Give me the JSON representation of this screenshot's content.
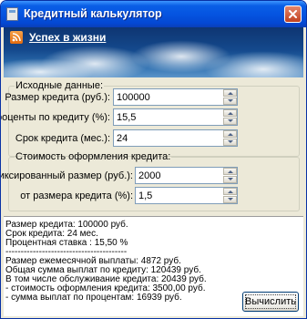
{
  "window": {
    "title": "Кредитный калькулятор"
  },
  "banner": {
    "link_text": "Успех в жизни"
  },
  "initial_group": {
    "legend": "Исходные данные:",
    "fields": [
      {
        "label": "Размер кредита (руб.):",
        "value": "100000"
      },
      {
        "label": "Проценты по кредиту (%):",
        "value": "15,5"
      },
      {
        "label": "Срок кредита (мес.):",
        "value": "24"
      }
    ]
  },
  "cost_group": {
    "legend": "Стоимость оформления кредита:",
    "fields": [
      {
        "label": "фиксированный размер (руб.):",
        "value": "2000"
      },
      {
        "label": "от размера кредита (%):",
        "value": "1,5"
      }
    ]
  },
  "results": {
    "lines": [
      "Размер кредита: 100000 руб.",
      "Срок кредита: 24 мес.",
      "Процентная ставка : 15,50 %",
      "----------------------------------------",
      "Размер ежемесячной выплаты: 4872 руб.",
      "Общая сумма выплат по кредиту: 120439 руб.",
      "В том числе обслуживание кредита: 20439 руб.",
      " - стоимость оформления кредита: 3500,00 руб.",
      " - сумма выплат по процентам: 16939 руб."
    ],
    "calculate_label": "Вычислить"
  }
}
